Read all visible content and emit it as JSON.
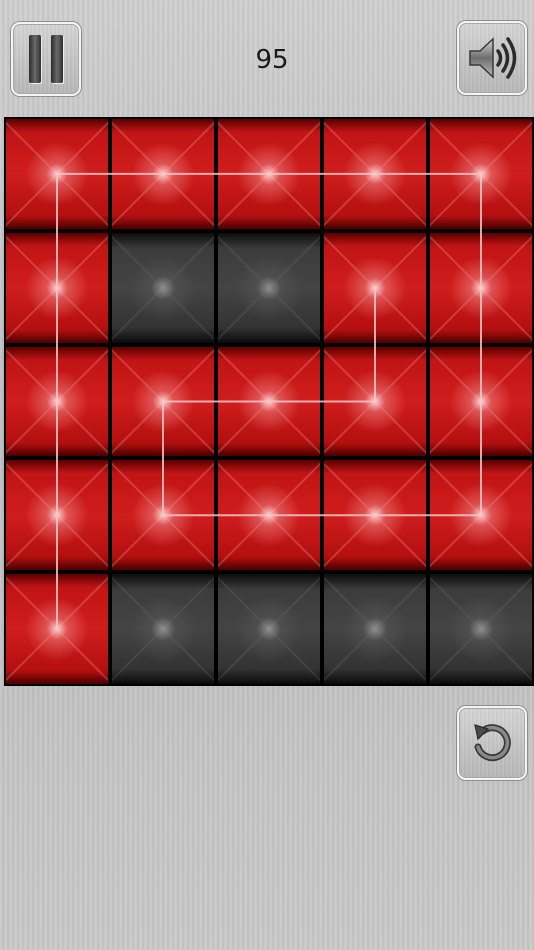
{
  "hud": {
    "score": "95",
    "pause_icon": "pause-icon",
    "sound_icon": "speaker-icon",
    "reset_icon": "restart-icon"
  },
  "board": {
    "rows": 5,
    "cols": 5,
    "cells": [
      [
        "on",
        "on",
        "on",
        "on",
        "on"
      ],
      [
        "on",
        "off",
        "off",
        "on",
        "on"
      ],
      [
        "on",
        "on",
        "on",
        "on",
        "on"
      ],
      [
        "on",
        "on",
        "on",
        "on",
        "on"
      ],
      [
        "on",
        "off",
        "off",
        "off",
        "off"
      ]
    ],
    "path": [
      [
        4,
        0
      ],
      [
        0,
        0
      ],
      [
        0,
        4
      ],
      [
        3,
        4
      ],
      [
        3,
        1
      ],
      [
        2,
        1
      ],
      [
        2,
        3
      ],
      [
        1,
        3
      ]
    ],
    "colors": {
      "lit": "#c81818",
      "unlit": "#3a3a3a",
      "path": "#f2c8c8"
    }
  }
}
